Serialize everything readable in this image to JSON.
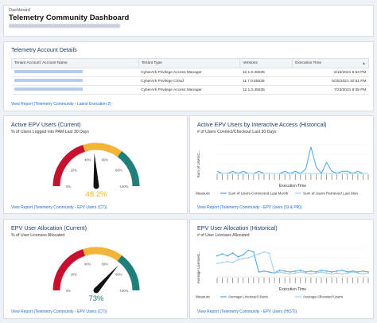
{
  "header": {
    "breadcrumb": "Dashboard",
    "title": "Telemetry Community Dashboard"
  },
  "accounts": {
    "title": "Telemetry Account Details",
    "columns": [
      "Tenant Account: Account Name",
      "Tenant Type",
      "Versions",
      "Execution Time"
    ],
    "rows": [
      {
        "type": "CyberArk Privilege Access Manager",
        "version": "12.1.0.45535",
        "time": "6/15/2021 6:53 PM"
      },
      {
        "type": "CyberArk Privilege Cloud",
        "version": "11.7.0.65535",
        "time": "5/25/2021 10:51 PM"
      },
      {
        "type": "CyberArk Privilege Access Manager",
        "version": "12.1.0.45535",
        "time": "7/23/2021 8:05 PM"
      }
    ],
    "view_report": "View Report (Telemetry Community - Latest Execution 2)"
  },
  "active_epv": {
    "title": "Active EPV Users (Current)",
    "subtitle": "% of Users Logged into PAM Last 30 Days",
    "gauge_value": 48.2,
    "gauge_label": "48.2%",
    "ticks": [
      "0%",
      "20%",
      "40%",
      "60%",
      "80%",
      "100%"
    ],
    "view_report": "View Report (Telemetry Community - EPV Users (CT))"
  },
  "active_epv_hist": {
    "title": "Active EPV Users by Interactive Access (Historical)",
    "subtitle": "# of Users Connect/Checkout Last 30 Days",
    "ylabel": "Sum of UsersC...",
    "xlabel": "Execution Time",
    "legend_label": "Measure",
    "series_names": [
      "Sum of Users Connected Last Month",
      "Sum of Users Retrieved Last Mon"
    ],
    "view_report": "View Report (Telemetry Community - EPV Users (SI & PR))"
  },
  "epv_alloc": {
    "title": "EPV User Allocation (Current)",
    "subtitle": "% of User Licenses Allocated",
    "gauge_value": 73,
    "gauge_label": "73%",
    "ticks": [
      "0%",
      "20%",
      "40%",
      "60%",
      "80%",
      "100%"
    ],
    "view_report": "View Report (Telemetry Community - EPV Users (CT))"
  },
  "epv_alloc_hist": {
    "title": "EPV User Allocation (Historical)",
    "subtitle": "# of User Licenses Allocated",
    "ylabel": "Average Licensed...",
    "xlabel": "Execution Time",
    "legend_label": "Measure",
    "series_names": [
      "Average Licensed Users",
      "Average Allocated Users"
    ],
    "view_report": "View Report (Telemetry Community - EPV Users (HIST))"
  },
  "colors": {
    "accent": "#1b6bd0",
    "gauge_red": "#c8102e",
    "gauge_yellow": "#f2b43a",
    "gauge_teal": "#1f7f7a",
    "line": "#4aa3df"
  },
  "chart_data": [
    {
      "type": "line",
      "title": "Active EPV Users by Interactive Access (Historical)",
      "xlabel": "Execution Time",
      "ylabel": "Sum of UsersC...",
      "series": [
        {
          "name": "Sum of Users Connected Last Month",
          "values": [
            1,
            0,
            0,
            1,
            0,
            1,
            0,
            0,
            1,
            0,
            0,
            0,
            0,
            1,
            0,
            1,
            0,
            2,
            12,
            3,
            0,
            5,
            1,
            0,
            1,
            1,
            0,
            1,
            0,
            0
          ]
        },
        {
          "name": "Sum of Users Retrieved Last Mon",
          "values": [
            0,
            0,
            0,
            0,
            0,
            0,
            0,
            0,
            0,
            0,
            0,
            0,
            0,
            0,
            0,
            0,
            0,
            0,
            0,
            0,
            0,
            0,
            0,
            0,
            0,
            0,
            0,
            0,
            0,
            0
          ]
        }
      ]
    },
    {
      "type": "line",
      "title": "EPV User Allocation (Historical)",
      "xlabel": "Execution Time",
      "ylabel": "Average Licensed...",
      "series": [
        {
          "name": "Average Licensed Users",
          "values": [
            22,
            24,
            22,
            25,
            21,
            23,
            28,
            26,
            5,
            6,
            5,
            4,
            7,
            6,
            5,
            6,
            7,
            5,
            6,
            5,
            7,
            6,
            5,
            6,
            7,
            5,
            6,
            5,
            6,
            5
          ]
        },
        {
          "name": "Average Allocated Users",
          "values": [
            14,
            15,
            16,
            15,
            18,
            19,
            20,
            22,
            24,
            26,
            25,
            4,
            5,
            4,
            3,
            4,
            5,
            4,
            3,
            4,
            5,
            4,
            3,
            4,
            3,
            4,
            5,
            4,
            3,
            4
          ]
        }
      ]
    }
  ]
}
